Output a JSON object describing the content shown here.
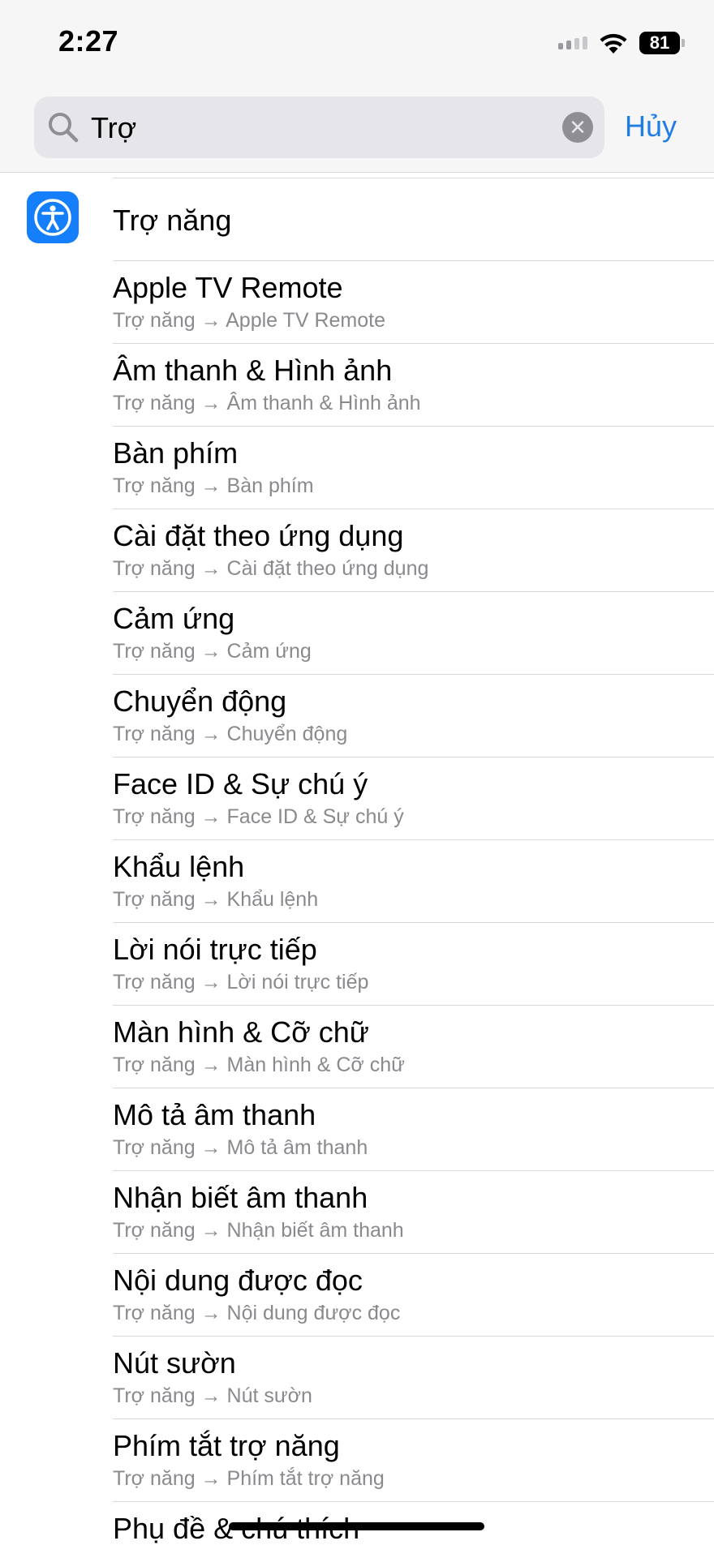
{
  "status_bar": {
    "time": "2:27",
    "battery": "81",
    "signal_icon": "cellular-signal-icon",
    "wifi_icon": "wifi-icon"
  },
  "search": {
    "query": "Trợ",
    "cancel_label": "Hủy",
    "icon": "search-icon",
    "clear_icon": "clear-icon"
  },
  "colors": {
    "accent": "#1f7de3",
    "app_icon": "#147efb",
    "secondary_text": "#8a8a8e"
  },
  "results": {
    "top_item": {
      "title": "Trợ năng",
      "icon": "accessibility-icon"
    },
    "items": [
      {
        "title": "Apple TV Remote",
        "subtitle": "Trợ năng → Apple TV Remote"
      },
      {
        "title": "Âm thanh & Hình ảnh",
        "subtitle": "Trợ năng → Âm thanh & Hình ảnh"
      },
      {
        "title": "Bàn phím",
        "subtitle": "Trợ năng → Bàn phím"
      },
      {
        "title": "Cài đặt theo ứng dụng",
        "subtitle": "Trợ năng → Cài đặt theo ứng dụng"
      },
      {
        "title": "Cảm ứng",
        "subtitle": "Trợ năng → Cảm ứng"
      },
      {
        "title": "Chuyển động",
        "subtitle": "Trợ năng → Chuyển động"
      },
      {
        "title": "Face ID & Sự chú ý",
        "subtitle": "Trợ năng → Face ID & Sự chú ý"
      },
      {
        "title": "Khẩu lệnh",
        "subtitle": "Trợ năng → Khẩu lệnh"
      },
      {
        "title": "Lời nói trực tiếp",
        "subtitle": "Trợ năng → Lời nói trực tiếp"
      },
      {
        "title": "Màn hình & Cỡ chữ",
        "subtitle": "Trợ năng → Màn hình & Cỡ chữ"
      },
      {
        "title": "Mô tả âm thanh",
        "subtitle": "Trợ năng → Mô tả âm thanh"
      },
      {
        "title": "Nhận biết âm thanh",
        "subtitle": "Trợ năng → Nhận biết âm thanh"
      },
      {
        "title": "Nội dung được đọc",
        "subtitle": "Trợ năng → Nội dung được đọc"
      },
      {
        "title": "Nút sườn",
        "subtitle": "Trợ năng → Nút sườn"
      },
      {
        "title": "Phím tắt trợ năng",
        "subtitle": "Trợ năng → Phím tắt trợ năng"
      },
      {
        "title": "Phụ đề & chú thích",
        "subtitle": ""
      }
    ]
  }
}
